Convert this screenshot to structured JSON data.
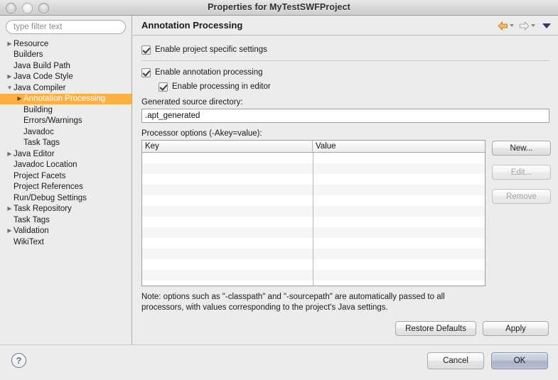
{
  "window": {
    "title": "Properties for MyTestSWFProject",
    "traffic_lights": [
      "close",
      "minimize",
      "zoom"
    ]
  },
  "sidebar": {
    "filter": {
      "value": "",
      "placeholder": "type filter text"
    },
    "items": [
      {
        "label": "Resource",
        "indent": 1,
        "twisty": "right",
        "selected": false
      },
      {
        "label": "Builders",
        "indent": 1,
        "twisty": "none",
        "selected": false
      },
      {
        "label": "Java Build Path",
        "indent": 1,
        "twisty": "none",
        "selected": false
      },
      {
        "label": "Java Code Style",
        "indent": 1,
        "twisty": "right",
        "selected": false
      },
      {
        "label": "Java Compiler",
        "indent": 1,
        "twisty": "down",
        "selected": false
      },
      {
        "label": "Annotation Processing",
        "indent": 2,
        "twisty": "right",
        "selected": true
      },
      {
        "label": "Building",
        "indent": 2,
        "twisty": "none",
        "selected": false
      },
      {
        "label": "Errors/Warnings",
        "indent": 2,
        "twisty": "none",
        "selected": false
      },
      {
        "label": "Javadoc",
        "indent": 2,
        "twisty": "none",
        "selected": false
      },
      {
        "label": "Task Tags",
        "indent": 2,
        "twisty": "none",
        "selected": false
      },
      {
        "label": "Java Editor",
        "indent": 1,
        "twisty": "right",
        "selected": false
      },
      {
        "label": "Javadoc Location",
        "indent": 1,
        "twisty": "none",
        "selected": false
      },
      {
        "label": "Project Facets",
        "indent": 1,
        "twisty": "none",
        "selected": false
      },
      {
        "label": "Project References",
        "indent": 1,
        "twisty": "none",
        "selected": false
      },
      {
        "label": "Run/Debug Settings",
        "indent": 1,
        "twisty": "none",
        "selected": false
      },
      {
        "label": "Task Repository",
        "indent": 1,
        "twisty": "right",
        "selected": false
      },
      {
        "label": "Task Tags",
        "indent": 1,
        "twisty": "none",
        "selected": false
      },
      {
        "label": "Validation",
        "indent": 1,
        "twisty": "right",
        "selected": false
      },
      {
        "label": "WikiText",
        "indent": 1,
        "twisty": "none",
        "selected": false
      }
    ]
  },
  "main": {
    "title": "Annotation Processing",
    "nav": {
      "back_icon": "back-arrow-icon",
      "forward_icon": "forward-arrow-icon",
      "menu_icon": "chevron-down-icon"
    },
    "checkboxes": [
      {
        "label": "Enable project specific settings",
        "checked": true
      },
      {
        "label": "Enable annotation processing",
        "checked": true
      },
      {
        "label": "Enable processing in editor",
        "checked": true
      }
    ],
    "generated_source": {
      "label": "Generated source directory:",
      "value": ".apt_generated",
      "placeholder": ""
    },
    "processor_options": {
      "label": "Processor options (-Akey=value):",
      "columns": [
        "Key",
        "Value"
      ],
      "rows": []
    },
    "side_buttons": [
      {
        "label": "New...",
        "enabled": true
      },
      {
        "label": "Edit...",
        "enabled": false
      },
      {
        "label": "Remove",
        "enabled": false
      }
    ],
    "note": "Note: options such as \"-classpath\" and \"-sourcepath\" are automatically passed to all processors, with values corresponding to the project's Java settings.",
    "bottom_buttons": {
      "restore_defaults": "Restore Defaults",
      "apply": "Apply"
    }
  },
  "footer": {
    "help_icon": "question-mark-icon",
    "cancel": "Cancel",
    "ok": "OK"
  },
  "colors": {
    "selection": "#fcb040",
    "selection_text": "#ffffff",
    "window_bg": "#ececec",
    "table_stripe": "#f5f6f8",
    "nav_back": "#e8a33d",
    "nav_menu": "#31356e"
  }
}
